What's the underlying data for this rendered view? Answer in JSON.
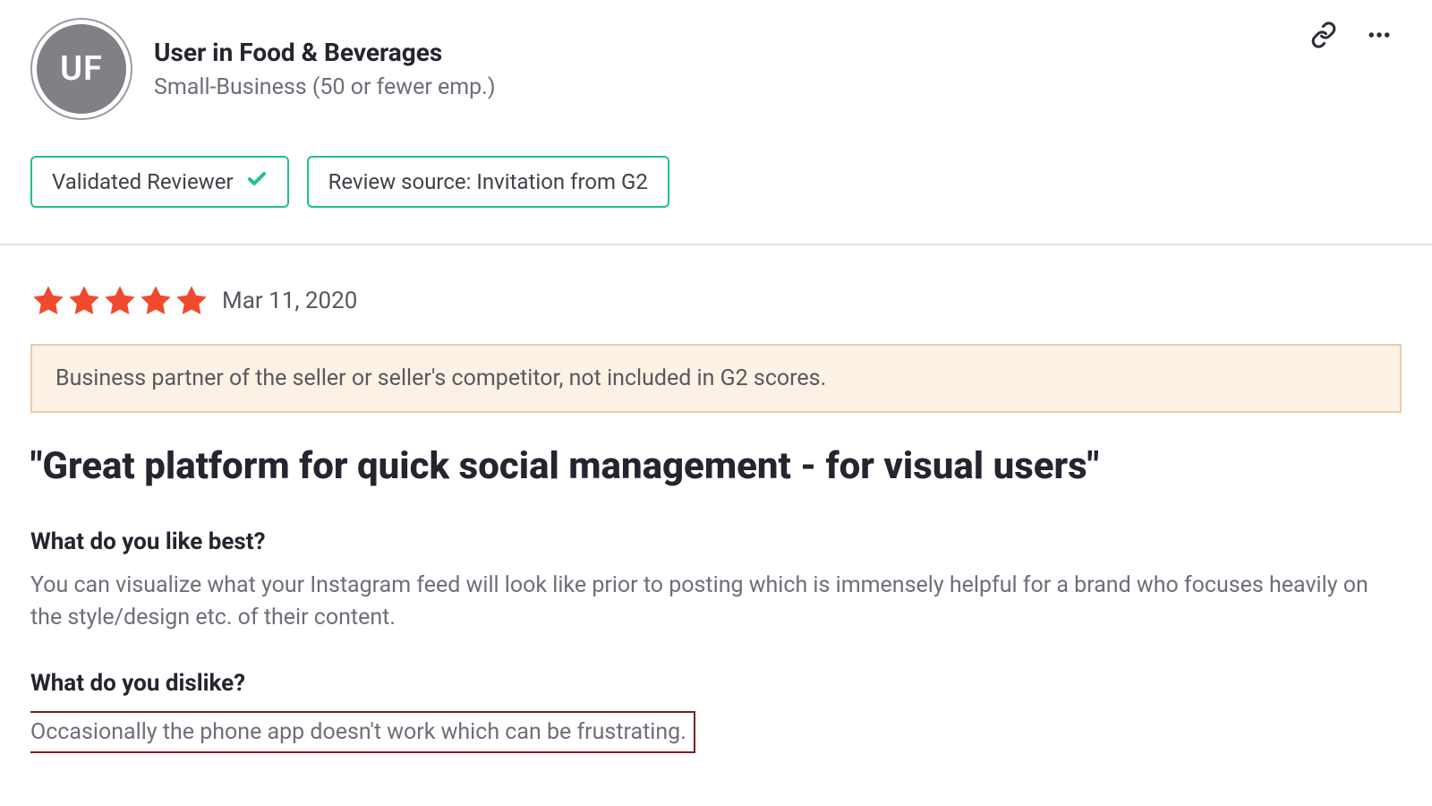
{
  "user": {
    "avatar_initials": "UF",
    "name": "User in Food & Beverages",
    "company": "Small-Business (50 or fewer emp.)"
  },
  "badges": {
    "validated": "Validated Reviewer",
    "source": "Review source: Invitation from G2"
  },
  "rating": {
    "stars": 5
  },
  "review": {
    "date": "Mar 11, 2020",
    "notice": "Business partner of the seller or seller's competitor, not included in G2 scores.",
    "title": "\"Great platform for quick social management - for visual users\"",
    "like_question": "What do you like best?",
    "like_answer": "You can visualize what your Instagram feed will look like prior to posting which is immensely helpful for a brand who focuses heavily on the style/design etc. of their content.",
    "dislike_question": "What do you dislike?",
    "dislike_answer": "Occasionally the phone app doesn't work which can be frustrating."
  },
  "colors": {
    "star": "#ef4a2e",
    "badge_border": "#22c08b"
  }
}
